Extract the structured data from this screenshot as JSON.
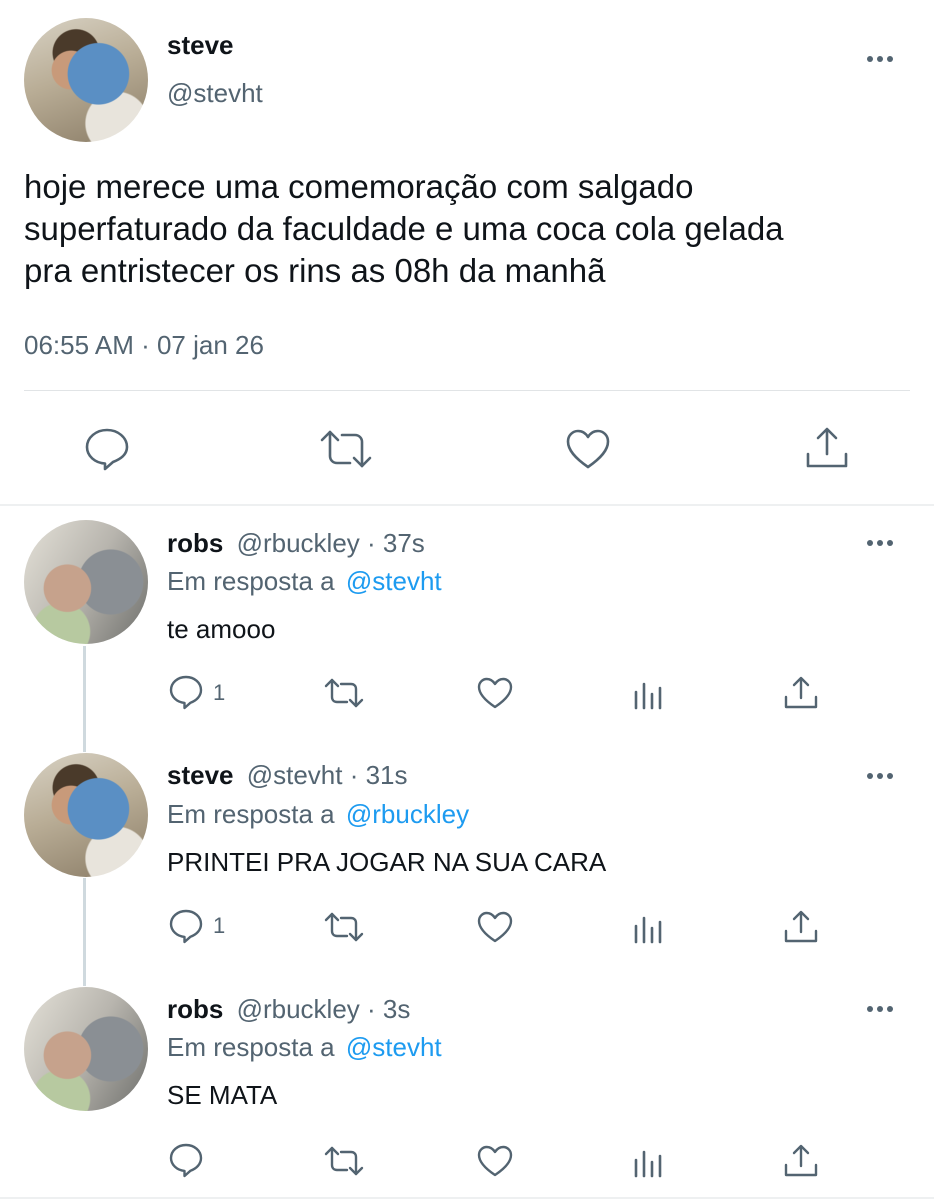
{
  "main_tweet": {
    "name": "steve",
    "handle": "@stevht",
    "text_lines": [
      "hoje merece uma comemoração com salgado",
      "superfaturado da faculdade e uma coca cola gelada",
      "pra entristecer os rins as 08h da manhã"
    ],
    "timestamp": "06:55 AM · 07 jan 26",
    "actions": [
      "reply-icon",
      "retweet-icon",
      "like-icon",
      "share-icon"
    ]
  },
  "replies": [
    {
      "name": "robs",
      "handle": "@rbuckley · 37s",
      "reply_prefix": "Em resposta a",
      "reply_to": "@stevht",
      "text": "te amooo",
      "reply_count": "1"
    },
    {
      "name": "steve",
      "handle": "@stevht · 31s",
      "reply_prefix": "Em resposta a",
      "reply_to": "@rbuckley",
      "text": "PRINTEI PRA JOGAR NA SUA CARA",
      "reply_count": "1"
    },
    {
      "name": "robs",
      "handle": "@rbuckley · 3s",
      "reply_prefix": "Em resposta a",
      "reply_to": "@stevht",
      "text": "SE MATA",
      "reply_count": ""
    }
  ],
  "colors": {
    "text": "#0f1419",
    "muted": "#536471",
    "link": "#1d9bf0",
    "divider": "#e1e4e6"
  }
}
